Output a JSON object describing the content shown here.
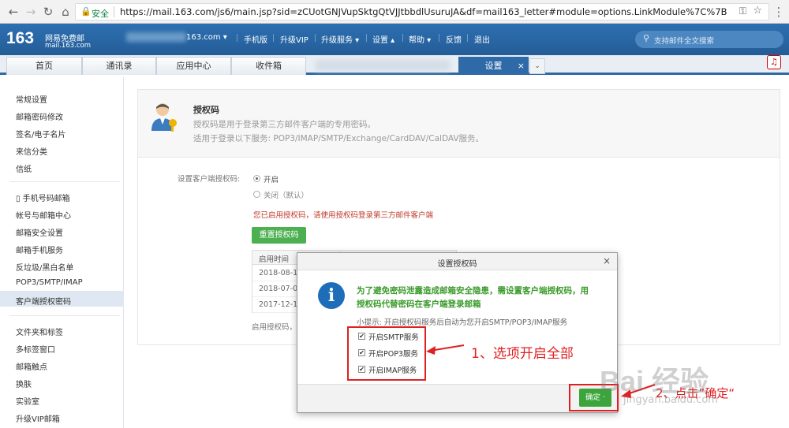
{
  "browser": {
    "secure_label": "安全",
    "url": "https://mail.163.com/js6/main.jsp?sid=zCUotGNJVupSktgQtVJJtbbdlUsuruJA&df=mail163_letter#module=options.LinkModule%7C%7B\"subMod..."
  },
  "header": {
    "logo_number": "163",
    "logo_name": "网易免费邮",
    "logo_domain": "mail.163.com",
    "account": "163.com ▾",
    "links": [
      "手机版",
      "升级VIP",
      "升级服务 ▾",
      "设置 ▴",
      "帮助 ▾",
      "反馈",
      "退出"
    ],
    "search_placeholder": "支持邮件全文搜索"
  },
  "tabs": [
    "首页",
    "通讯录",
    "应用中心",
    "收件箱",
    "设置"
  ],
  "tab_close": "×",
  "sidebar": {
    "group1": [
      "常规设置",
      "邮箱密码修改",
      "签名/电子名片",
      "来信分类",
      "信纸"
    ],
    "group2": [
      "▯ 手机号码邮箱",
      "帐号与邮箱中心",
      "邮箱安全设置",
      "邮箱手机服务",
      "反垃圾/黑白名单",
      "POP3/SMTP/IMAP",
      "客户端授权密码"
    ],
    "group3": [
      "文件夹和标签",
      "多标签窗口",
      "邮箱触点",
      "换肤",
      "实验室",
      "升级VIP邮箱"
    ]
  },
  "panel": {
    "title": "授权码",
    "desc1": "授权码是用于登录第三方邮件客户端的专用密码。",
    "desc2": "适用于登录以下服务: POP3/IMAP/SMTP/Exchange/CardDAV/CalDAV服务。",
    "setting_label": "设置客户端授权码:",
    "radio_on": "开启",
    "radio_off": "关闭（默认）",
    "enabled_msg": "您已启用授权码，请使用授权码登录第三方邮件客户端",
    "reset_button": "重置授权码",
    "table_header": "启用时间",
    "table_rows": [
      "2018-08-1",
      "2018-07-0",
      "2017-12-1"
    ],
    "footnote": "启用授权码，"
  },
  "dialog": {
    "title": "设置授权码",
    "close": "×",
    "warn1": "为了避免密码泄露造成邮箱安全隐患，需设置客户端授权码，用",
    "warn2": "授权码代替密码在客户端登录邮箱",
    "tip": "小提示: 开启授权码服务后自动为您开启SMTP/POP3/IMAP服务",
    "options": [
      "开启SMTP服务",
      "开启POP3服务",
      "开启IMAP服务"
    ],
    "ok_button": "确定 ·"
  },
  "annotations": {
    "step1": "1、选项开启全部",
    "step2": "2、点击”确定“"
  },
  "watermark": {
    "text": "Bai 经验",
    "sub": "jingyan.baidu.com"
  }
}
